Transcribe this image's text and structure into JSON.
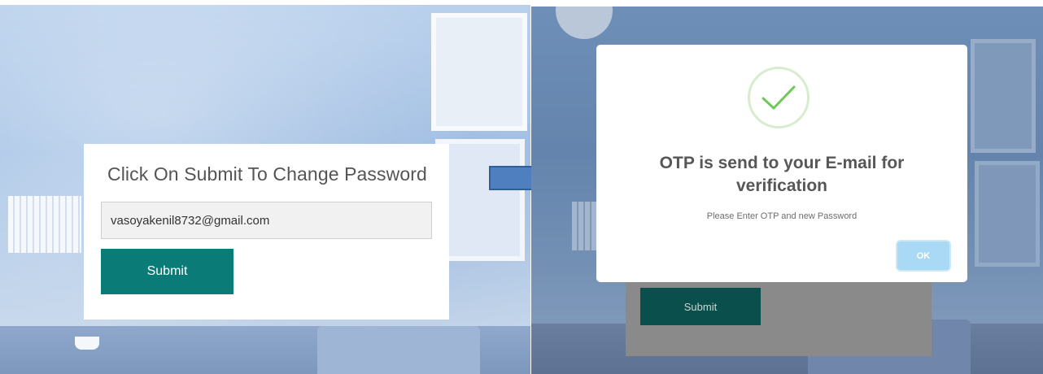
{
  "left": {
    "title": "Click On Submit To Change Password",
    "email_value": "vasoyakenil8732@gmail.com",
    "submit_label": "Submit"
  },
  "right": {
    "modal": {
      "title_line1": "OTP is send to your E-mail for",
      "title_line2": "verification",
      "text": "Please Enter OTP and new Password",
      "ok_label": "OK",
      "icon": "checkmark-icon"
    },
    "background_submit_label": "Submit"
  },
  "colors": {
    "submit": "#0b7b77",
    "ok_button": "#a9d9f4",
    "check": "#6fc95a",
    "arrow": "#4f7fbf"
  }
}
